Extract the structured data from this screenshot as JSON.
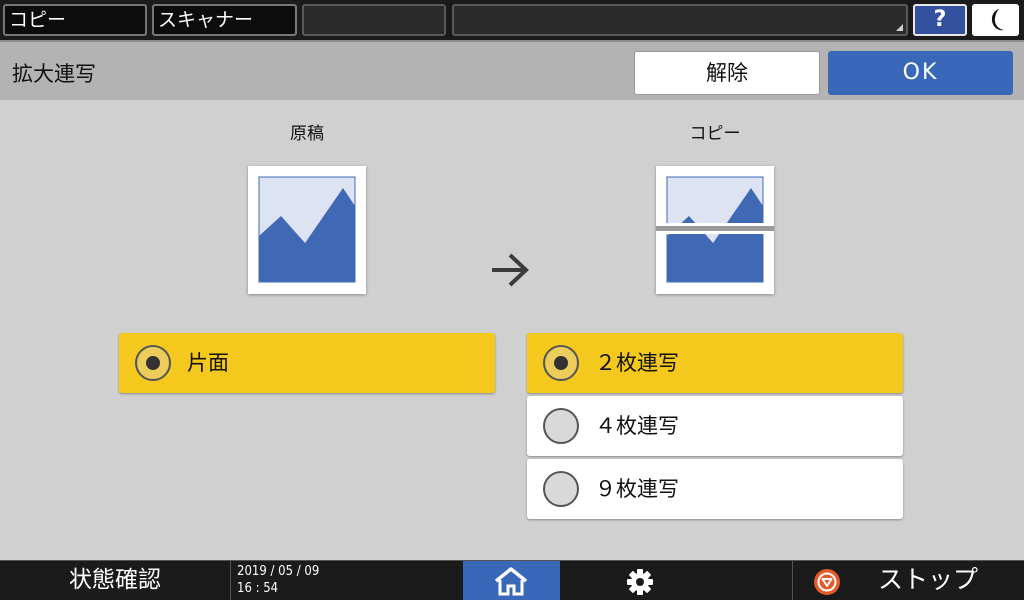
{
  "topbar": {
    "tabs": [
      {
        "label": "コピー"
      },
      {
        "label": "スキャナー"
      },
      {
        "label": ""
      },
      {
        "label": ""
      }
    ],
    "help_label": "?",
    "moon_icon": "moon-icon"
  },
  "header": {
    "title": "拡大連写",
    "cancel_label": "解除",
    "ok_label": "OK"
  },
  "preview": {
    "original_label": "原稿",
    "copy_label": "コピー"
  },
  "options": {
    "source": [
      {
        "label": "片面",
        "selected": true
      }
    ],
    "output": [
      {
        "label": "２枚連写",
        "selected": true
      },
      {
        "label": "４枚連写",
        "selected": false
      },
      {
        "label": "９枚連写",
        "selected": false
      }
    ]
  },
  "bottombar": {
    "status_label": "状態確認",
    "date": "2019 / 05 / 09",
    "time": "16 : 54",
    "stop_label": "ストップ"
  },
  "colors": {
    "accent_blue": "#3a68b8",
    "selected_yellow": "#f4c81c",
    "image_blue": "#3f68b5",
    "stop_orange": "#e25a2a"
  }
}
